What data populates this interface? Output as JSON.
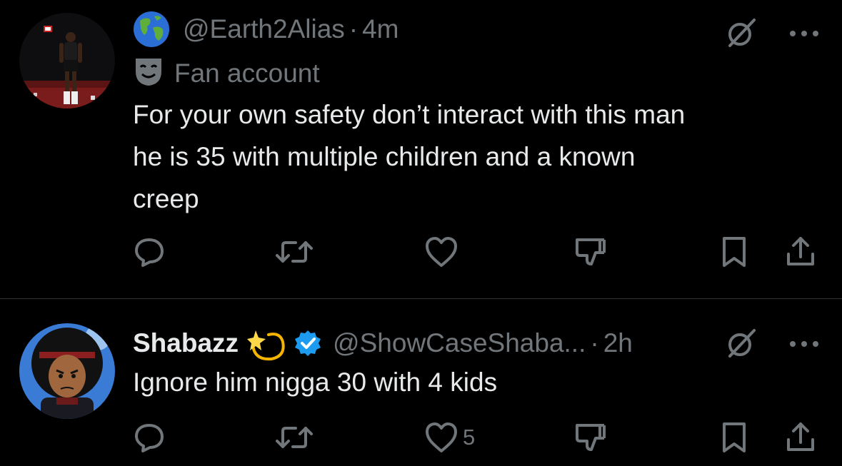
{
  "colors": {
    "background": "#000000",
    "text": "#e7e9ea",
    "muted": "#71767b",
    "divider": "#2f3336",
    "verified": "#1d9bf0"
  },
  "tweets": [
    {
      "handle": "@Earth2Alias",
      "separator": "·",
      "time": "4m",
      "label": "Fan account",
      "text_lines": [
        "For your own safety don’t interact with this man",
        "he is 35 with multiple children and a known",
        "creep"
      ],
      "icons": [
        "globe-icon",
        "theater-mask-icon",
        "grok-icon",
        "more-icon",
        "reply-icon",
        "retweet-icon",
        "like-icon",
        "downvote-icon",
        "bookmark-icon",
        "share-icon"
      ]
    },
    {
      "name": "Shabazz",
      "name_emoji": "💫",
      "handle": "@ShowCaseShaba...",
      "separator": "·",
      "time": "2h",
      "text_lines": [
        "Ignore him nigga 30 with 4 kids"
      ],
      "like_count": "5",
      "icons": [
        "dizzy-icon",
        "verified-badge-icon",
        "grok-icon",
        "more-icon",
        "reply-icon",
        "retweet-icon",
        "like-icon",
        "downvote-icon",
        "bookmark-icon",
        "share-icon"
      ]
    }
  ]
}
